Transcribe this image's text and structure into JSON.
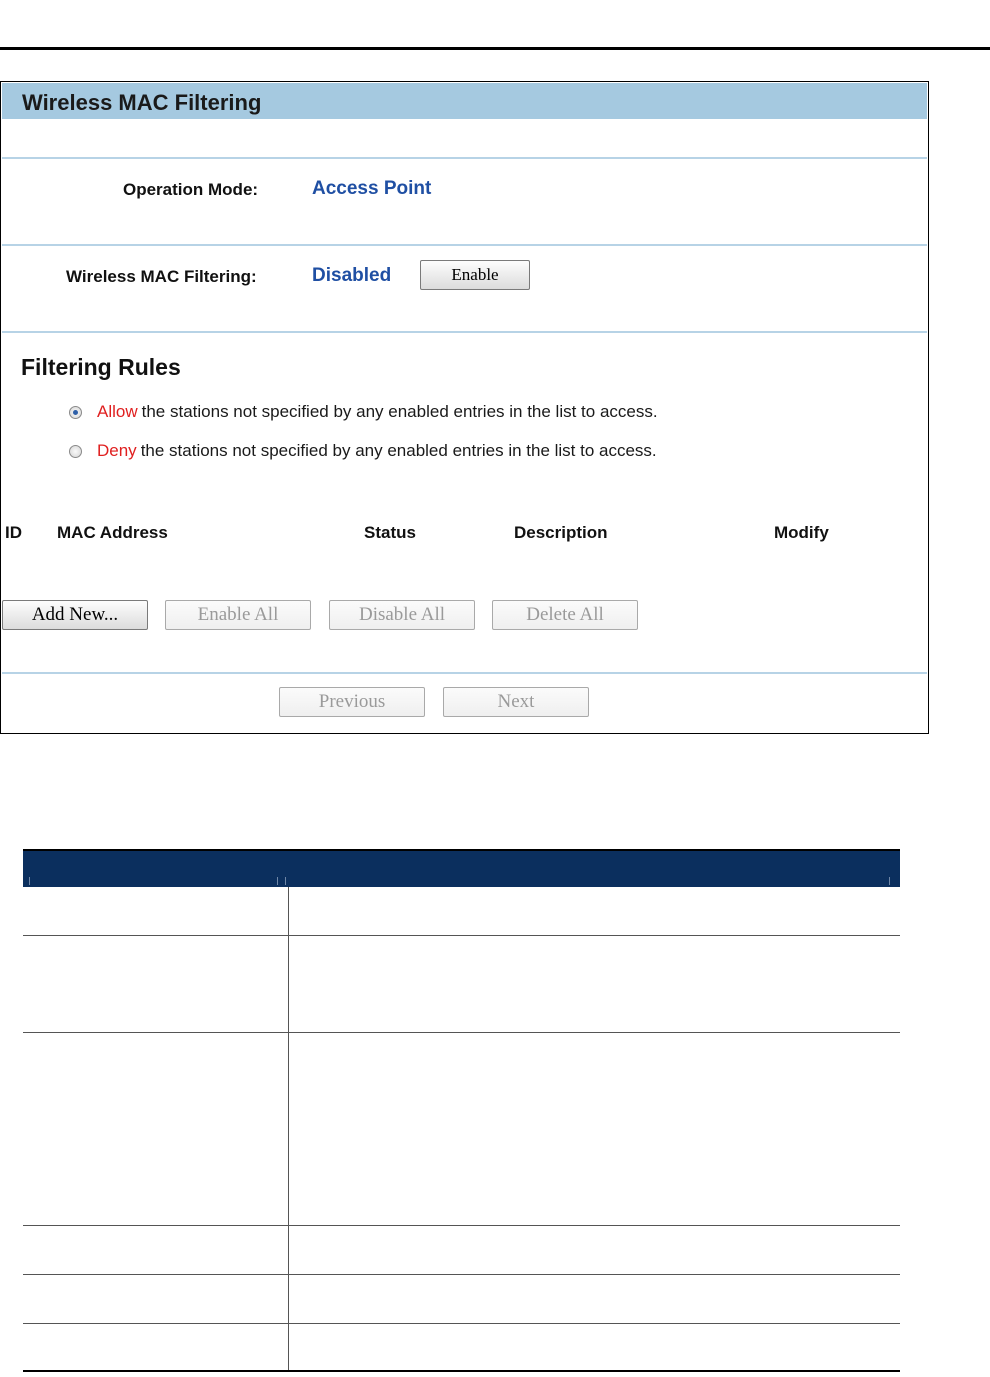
{
  "panel": {
    "title": "Wireless MAC Filtering"
  },
  "operation_mode": {
    "label": "Operation Mode:",
    "value": "Access Point"
  },
  "mac_filtering": {
    "label": "Wireless MAC Filtering:",
    "value": "Disabled",
    "enable_button": "Enable"
  },
  "filtering_rules": {
    "title": "Filtering Rules",
    "options": [
      {
        "keyword": "Allow",
        "text": "the stations not specified by any enabled entries in the list to access.",
        "selected": true
      },
      {
        "keyword": "Deny",
        "text": "the stations not specified by any enabled entries in the list to access.",
        "selected": false
      }
    ]
  },
  "entries_table": {
    "columns": [
      "ID",
      "MAC Address",
      "Status",
      "Description",
      "Modify"
    ]
  },
  "actions": {
    "add_new": "Add New...",
    "enable_all": "Enable All",
    "disable_all": "Disable All",
    "delete_all": "Delete All"
  },
  "pagination": {
    "previous": "Previous",
    "next": "Next"
  },
  "colors": {
    "header_bar": "#a5c9e0",
    "value_blue": "#1f4fa3",
    "keyword_red": "#e02020",
    "table_header": "#0b2f5e"
  }
}
